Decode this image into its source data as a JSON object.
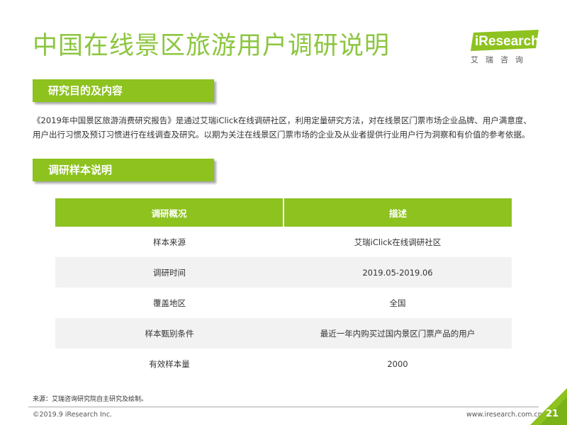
{
  "header": {
    "title": "中国在线景区旅游用户调研说明",
    "logo_text": "iResearch",
    "logo_cn": "艾瑞咨询"
  },
  "section1": {
    "title": "研究目的及内容",
    "body_line1": "《2019年中国景区旅游消费研究报告》是通过艾瑞iClick在线调研社区，利用定量研究方法，对在线景区门票市场企业品牌、用户满意度、",
    "body_line2": "用户出行习惯及预订习惯进行在线调查及研究。以期为关注在线景区门票市场的企业及从业者提供行业用户行为洞察和有价值的参考依据。"
  },
  "section2": {
    "title": "调研样本说明"
  },
  "table": {
    "headers": [
      "调研概况",
      "描述"
    ],
    "rows": [
      [
        "样本来源",
        "艾瑞iClick在线调研社区"
      ],
      [
        "调研时间",
        "2019.05-2019.06"
      ],
      [
        "覆盖地区",
        "全国"
      ],
      [
        "样本甄别条件",
        "最近一年内购买过国内景区门票产品的用户"
      ],
      [
        "有效样本量",
        "2000"
      ]
    ]
  },
  "footer": {
    "source": "来源：艾瑞咨询研究院自主研究及绘制。",
    "copyright": "©2019.9 iResearch Inc.",
    "website": "www.iresearch.com.cn",
    "page_number": "21"
  },
  "colors": {
    "accent": "#8dc21f",
    "title": "#8cc63f",
    "row_alt": "#f2f2f2"
  }
}
